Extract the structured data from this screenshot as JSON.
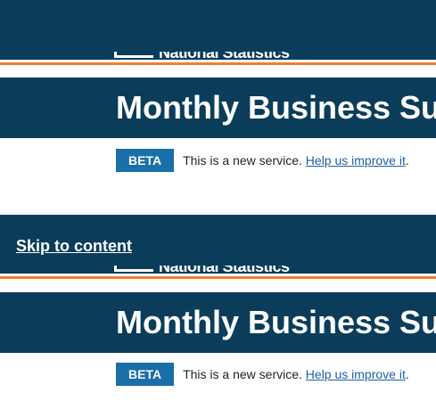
{
  "header": {
    "logo_text": "National Statistics",
    "title": "Monthly Business Survey"
  },
  "phase_banner": {
    "tag": "BETA",
    "message": "This is a new service.",
    "link_text": "Help us improve it",
    "suffix": "."
  },
  "skip_link": "Skip to content",
  "colors": {
    "header_bg": "#0b3d5a",
    "accent_rule": "#f07f2b",
    "beta_tag": "#1a6fa8",
    "link": "#1f5fa3"
  }
}
